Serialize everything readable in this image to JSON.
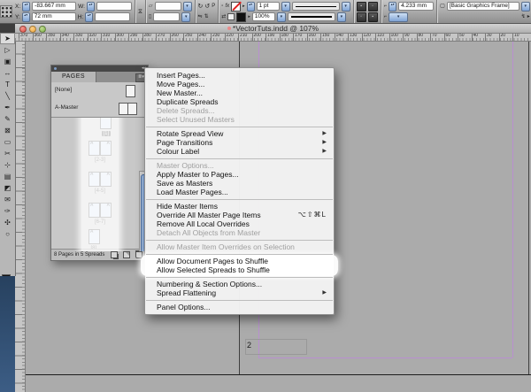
{
  "colors": {
    "desktop_blue": "#2e4a6b",
    "guide_purple": "#b98fd0",
    "scrollbar_blue": "#5e87c2",
    "stroke_none_red": "#dd2222",
    "annotation_highlight": "#ffffff",
    "pasteboard_gray": "#ababab"
  },
  "control_panel": {
    "x_label": "X:",
    "x_value": "-83.667 mm",
    "y_label": "Y:",
    "y_value": "72 mm",
    "w_label": "W:",
    "w_value": "",
    "h_label": "H:",
    "h_value": "",
    "stroke_weight": "1 pt",
    "fx_label": "fx",
    "opacity": "100%",
    "corner_radius": "4.233 mm",
    "object_style": "[Basic Graphics Frame]"
  },
  "window": {
    "title": "*VectorTuts.indd @ 107%"
  },
  "h_ruler_ticks": [
    370,
    360,
    350,
    340,
    330,
    320,
    310,
    300,
    290,
    280,
    270,
    260,
    250,
    240,
    230,
    220,
    210,
    200,
    190,
    180,
    170,
    160,
    150,
    140,
    130,
    120,
    110,
    100,
    90,
    80,
    70,
    60,
    50,
    40,
    30,
    20,
    10
  ],
  "tools": [
    {
      "name": "selection-tool",
      "glyph": "➤",
      "selected": true
    },
    {
      "name": "direct-selection-tool",
      "glyph": "▷"
    },
    {
      "name": "page-tool",
      "glyph": "▣"
    },
    {
      "name": "gap-tool",
      "glyph": "↔"
    },
    {
      "name": "type-tool",
      "glyph": "T"
    },
    {
      "name": "line-tool",
      "glyph": "╲"
    },
    {
      "name": "pen-tool",
      "glyph": "✒"
    },
    {
      "name": "pencil-tool",
      "glyph": "✎"
    },
    {
      "name": "rectangle-frame-tool",
      "glyph": "⊠"
    },
    {
      "name": "rectangle-tool",
      "glyph": "▭"
    },
    {
      "name": "scissors-tool",
      "glyph": "✂"
    },
    {
      "name": "free-transform-tool",
      "glyph": "⊹"
    },
    {
      "name": "gradient-swatch-tool",
      "glyph": "▤"
    },
    {
      "name": "gradient-feather-tool",
      "glyph": "◩"
    },
    {
      "name": "note-tool",
      "glyph": "✉"
    },
    {
      "name": "eyedropper-tool",
      "glyph": "✑"
    },
    {
      "name": "hand-tool",
      "glyph": "✣"
    },
    {
      "name": "zoom-tool",
      "glyph": "○"
    }
  ],
  "pages_panel": {
    "tab": "PAGES",
    "master_letter": "A",
    "masters": [
      {
        "label": "[None]",
        "type": "single"
      },
      {
        "label": "A-Master",
        "type": "spread"
      }
    ],
    "spreads": [
      {
        "label": "[1]",
        "type": "single-right",
        "selected": true,
        "marker": true
      },
      {
        "label": "[2-3]",
        "type": "spread"
      },
      {
        "label": "[4-5]",
        "type": "spread"
      },
      {
        "label": "[6-7]",
        "type": "spread"
      },
      {
        "label": "[8]",
        "type": "single-left"
      }
    ],
    "status": "8 Pages in 5 Spreads"
  },
  "menu": {
    "items": [
      {
        "label": "Insert Pages..."
      },
      {
        "label": "Move Pages..."
      },
      {
        "label": "New Master..."
      },
      {
        "label": "Duplicate Spreads"
      },
      {
        "label": "Delete Spreads...",
        "disabled": true
      },
      {
        "label": "Select Unused Masters",
        "disabled": true
      },
      {
        "separator": true
      },
      {
        "label": "Rotate Spread View",
        "submenu": true
      },
      {
        "label": "Page Transitions",
        "submenu": true
      },
      {
        "label": "Colour Label",
        "submenu": true
      },
      {
        "separator": true
      },
      {
        "label": "Master Options...",
        "disabled": true
      },
      {
        "label": "Apply Master to Pages..."
      },
      {
        "label": "Save as Masters"
      },
      {
        "label": "Load Master Pages..."
      },
      {
        "separator": true
      },
      {
        "label": "Hide Master Items"
      },
      {
        "label": "Override All Master Page Items",
        "shortcut": "⌥⇧⌘L"
      },
      {
        "label": "Remove All Local Overrides"
      },
      {
        "label": "Detach All Objects from Master",
        "disabled": true
      },
      {
        "separator": true
      },
      {
        "label": "Allow Master Item Overrides on Selection",
        "disabled": true
      },
      {
        "separator": true
      },
      {
        "label": "Allow Document Pages to Shuffle",
        "highlighted": true
      },
      {
        "label": "Allow Selected Spreads to Shuffle",
        "highlighted": true
      },
      {
        "separator": true
      },
      {
        "label": "Numbering & Section Options..."
      },
      {
        "label": "Spread Flattening",
        "submenu": true
      },
      {
        "separator": true
      },
      {
        "label": "Panel Options..."
      }
    ]
  },
  "document": {
    "page_number": "2"
  }
}
